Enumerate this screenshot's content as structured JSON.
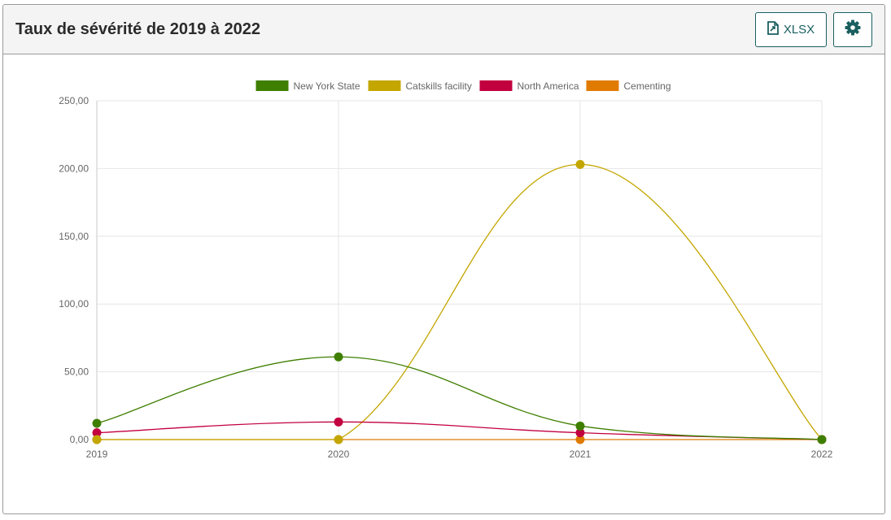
{
  "header": {
    "title": "Taux de sévérité de 2019 à 2022",
    "export_label": "XLSX",
    "export_icon": "file-export-icon",
    "settings_icon": "gear-icon"
  },
  "chart_data": {
    "type": "line",
    "categories": [
      "2019",
      "2020",
      "2021",
      "2022"
    ],
    "ylim": [
      0,
      250
    ],
    "yticks": [
      "0,00",
      "50,00",
      "100,00",
      "150,00",
      "200,00",
      "250,00"
    ],
    "ytick_values": [
      0,
      50,
      100,
      150,
      200,
      250
    ],
    "grid": true,
    "legend_position": "top",
    "series": [
      {
        "name": "New York State",
        "color": "#3f7f00",
        "values": [
          12,
          61,
          10,
          0
        ]
      },
      {
        "name": "Catskills facility",
        "color": "#c4a600",
        "values": [
          0,
          0,
          203,
          0
        ]
      },
      {
        "name": "North America",
        "color": "#c2003f",
        "values": [
          5,
          13,
          5,
          0
        ]
      },
      {
        "name": "Cementing",
        "color": "#e07b00",
        "values": [
          0,
          0,
          0,
          0
        ]
      }
    ]
  }
}
